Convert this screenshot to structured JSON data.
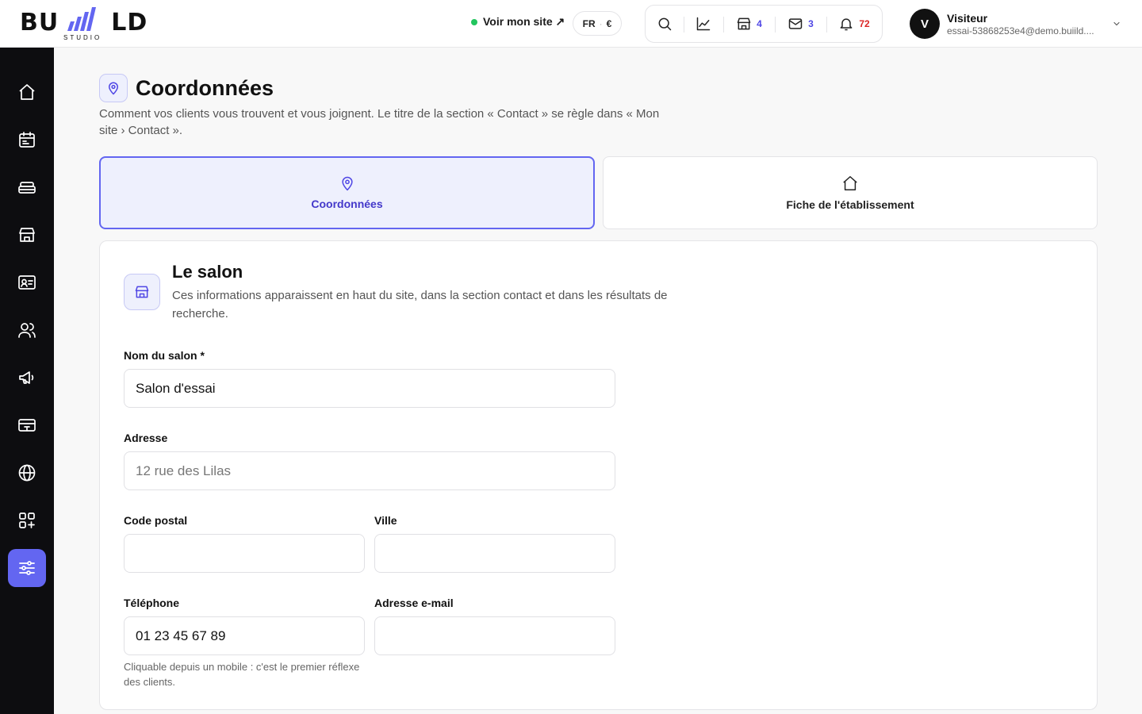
{
  "brand": {
    "word_left": "BU",
    "word_right": "LD",
    "sub": "STUDIO",
    "accent": "#6366f1"
  },
  "header": {
    "view_site": "Voir mon site ↗",
    "locale": {
      "lang": "FR",
      "sep": "·",
      "currency": "€"
    },
    "toolbar": {
      "search_icon": "search-icon",
      "stats_icon": "chart-icon",
      "shop_count": "4",
      "mail_count": "3",
      "notif_count": "72"
    },
    "user": {
      "initial": "V",
      "name": "Visiteur",
      "email": "essai-53868253e4@demo.buiild...."
    }
  },
  "sidebar": {
    "items": [
      {
        "name": "home",
        "icon": "home-icon"
      },
      {
        "name": "calendar",
        "icon": "calendar-icon"
      },
      {
        "name": "services",
        "icon": "tray-icon"
      },
      {
        "name": "shop",
        "icon": "store-icon"
      },
      {
        "name": "contacts",
        "icon": "contact-card-icon"
      },
      {
        "name": "team",
        "icon": "users-icon"
      },
      {
        "name": "marketing",
        "icon": "megaphone-icon"
      },
      {
        "name": "payments",
        "icon": "card-icon"
      },
      {
        "name": "website",
        "icon": "globe-icon"
      },
      {
        "name": "apps",
        "icon": "apps-icon"
      },
      {
        "name": "settings",
        "icon": "sliders-icon",
        "active": true
      }
    ]
  },
  "page": {
    "title": "Coordonnées",
    "description": "Comment vos clients vous trouvent et vous joignent. Le titre de la section « Contact » se règle dans « Mon site › Contact ».",
    "tabs": [
      {
        "label": "Coordonnées",
        "active": true
      },
      {
        "label": "Fiche de l'établissement",
        "active": false
      }
    ]
  },
  "card": {
    "title": "Le salon",
    "description": "Ces informations apparaissent en haut du site, dans la section contact et dans les résultats de recherche.",
    "fields": {
      "name": {
        "label": "Nom du salon *",
        "value": "Salon d'essai",
        "placeholder": ""
      },
      "address": {
        "label": "Adresse",
        "value": "",
        "placeholder": "12 rue des Lilas"
      },
      "postal": {
        "label": "Code postal",
        "value": "",
        "placeholder": ""
      },
      "city": {
        "label": "Ville",
        "value": "",
        "placeholder": ""
      },
      "phone": {
        "label": "Téléphone",
        "value": "01 23 45 67 89",
        "placeholder": "",
        "help": "Cliquable depuis un mobile : c'est le premier réflexe des clients."
      },
      "email": {
        "label": "Adresse e-mail",
        "value": "",
        "placeholder": ""
      }
    }
  }
}
